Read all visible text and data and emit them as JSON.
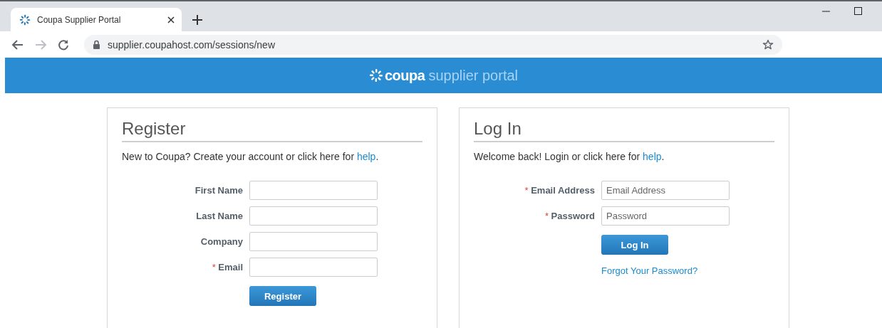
{
  "browser": {
    "tab": {
      "title": "Coupa Supplier Portal",
      "selected": true
    },
    "url": "supplier.coupahost.com/sessions/new"
  },
  "banner": {
    "brand": "coupa",
    "tagline": "supplier portal"
  },
  "panels": [
    {
      "kind": "register",
      "title": "Register",
      "intro": {
        "text": "New to Coupa? Create your account or click here for ",
        "link": "help",
        "after": "."
      },
      "fields": [
        {
          "label": "First Name"
        },
        {
          "label": "Last Name"
        },
        {
          "label": "Company"
        },
        {
          "label": "Email",
          "required_mark": "*"
        }
      ],
      "button": "Register"
    },
    {
      "kind": "login",
      "title": "Log In",
      "intro": {
        "text": "Welcome back! Login or click here for ",
        "link": "help",
        "after": "."
      },
      "fields": [
        {
          "label": "Email Address",
          "required_mark": "*",
          "placeholder": "Email Address"
        },
        {
          "label": "Password",
          "required_mark": "*",
          "placeholder": "Password"
        }
      ],
      "button": "Log In",
      "forgot_link": "Forgot Your Password?"
    }
  ]
}
